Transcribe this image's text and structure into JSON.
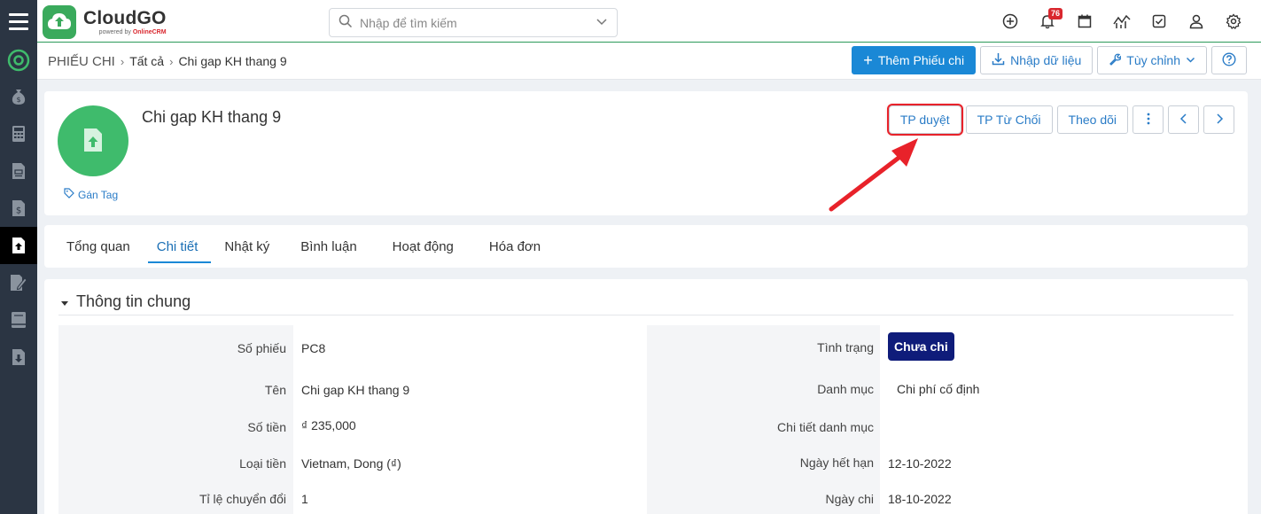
{
  "app": {
    "brand": "CloudGO",
    "brand_sub_prefix": "powered by",
    "brand_sub_name": "OnlineCRM",
    "notification_count": "76"
  },
  "search": {
    "placeholder": "Nhập để tìm kiếm"
  },
  "breadcrumb": {
    "module": "Phiếu chi",
    "all": "Tất cả",
    "record": "Chi gap KH thang 9"
  },
  "toolbar": {
    "add_label": "Thêm Phiếu chi",
    "import_label": "Nhập dữ liệu",
    "customize_label": "Tùy chỉnh"
  },
  "record": {
    "title": "Chi gap KH thang 9",
    "tag_label": "Gán Tag",
    "approve_label": "TP duyệt",
    "reject_label": "TP Từ Chối",
    "follow_label": "Theo dõi"
  },
  "tabs": [
    {
      "label": "Tổng quan"
    },
    {
      "label": "Chi tiết"
    },
    {
      "label": "Nhật ký"
    },
    {
      "label": "Bình luận"
    },
    {
      "label": "Hoạt động"
    },
    {
      "label": "Hóa đơn"
    }
  ],
  "section": {
    "title": "Thông tin chung"
  },
  "fields_left": [
    {
      "label": "Số phiếu",
      "value": "PC8"
    },
    {
      "label": "Tên",
      "value": "Chi gap KH thang 9"
    },
    {
      "label": "Số tiền",
      "value": "₫ 235,000"
    },
    {
      "label": "Loại tiền",
      "value": "Vietnam, Dong (₫)"
    },
    {
      "label": "Tỉ lệ chuyển đổi",
      "value": "1"
    }
  ],
  "fields_right": [
    {
      "label": "Tình trạng",
      "value": "Chưa chi"
    },
    {
      "label": "Danh mục",
      "value": "Chi phí cố định"
    },
    {
      "label": "Chi tiết danh mục",
      "value": ""
    },
    {
      "label": "Ngày hết hạn",
      "value": "12-10-2022"
    },
    {
      "label": "Ngày chi",
      "value": "18-10-2022"
    }
  ],
  "colors": {
    "accent": "#1a88d6",
    "brand_green": "#3aaa5c",
    "status_badge": "#0f1c7a",
    "highlight": "#e8222a"
  }
}
